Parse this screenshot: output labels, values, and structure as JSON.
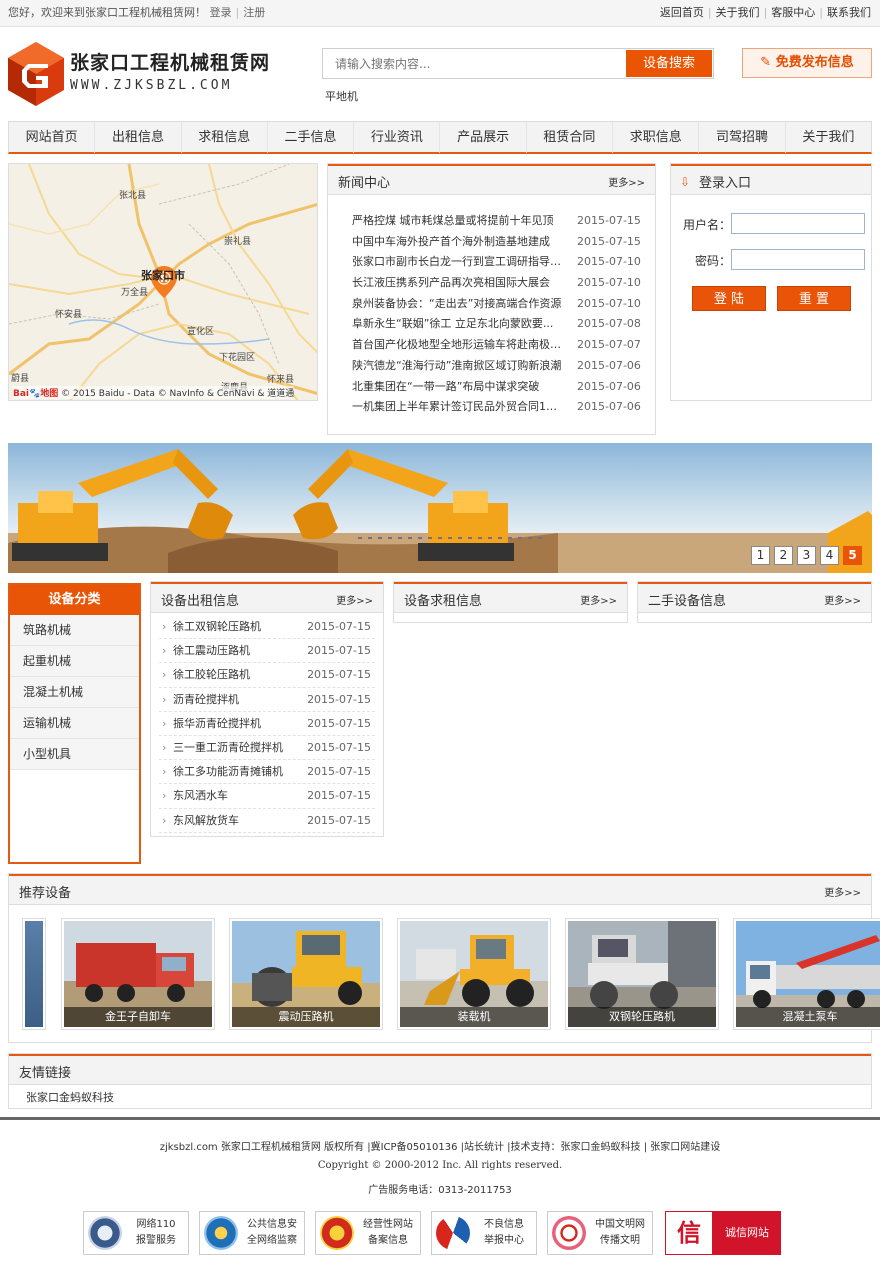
{
  "topbar": {
    "welcome": "您好，欢迎来到张家口工程机械租赁网！",
    "login": "登录",
    "register": "注册",
    "links": [
      "返回首页",
      "关于我们",
      "客服中心",
      "联系我们"
    ]
  },
  "header": {
    "logo_cn": "张家口工程机械租赁网",
    "logo_en": "WWW.ZJKSBZL.COM",
    "search_placeholder": "请输入搜索内容...",
    "search_button": "设备搜索",
    "hot_keyword": "平地机",
    "publish_button": "免费发布信息"
  },
  "nav": [
    "网站首页",
    "出租信息",
    "求租信息",
    "二手信息",
    "行业资讯",
    "产品展示",
    "租赁合同",
    "求职信息",
    "司驾招聘",
    "关于我们"
  ],
  "map": {
    "labels": [
      "张北县",
      "崇礼县",
      "张家口市",
      "万全县",
      "怀安县",
      "宣化区",
      "下花园区",
      "怀来县",
      "涿鹿县",
      "蔚县"
    ],
    "copyright": "© 2015 Baidu - Data © NavInfo & CenNavi & 道道通",
    "brand": "Bai",
    "brand2": "地图"
  },
  "news": {
    "title": "新闻中心",
    "more": "更多>>",
    "items": [
      {
        "title": "严格控煤 城市耗煤总量或将提前十年见顶",
        "date": "2015-07-15"
      },
      {
        "title": "中国中车海外投产首个海外制造基地建成",
        "date": "2015-07-15"
      },
      {
        "title": "张家口市副市长白龙一行到宣工调研指导工作",
        "date": "2015-07-10"
      },
      {
        "title": "长江液压携系列产品再次亮相国际大展会",
        "date": "2015-07-10"
      },
      {
        "title": "泉州装备协会：“走出去”对接高端合作资源",
        "date": "2015-07-10"
      },
      {
        "title": "阜新永生“联姻”徐工 立足东北向蒙欧要...",
        "date": "2015-07-08"
      },
      {
        "title": "首台国产化极地型全地形运输车将赴南极科考",
        "date": "2015-07-07"
      },
      {
        "title": "陕汽德龙“淮海行动”淮南掀区域订购新浪潮",
        "date": "2015-07-06"
      },
      {
        "title": "北重集团在“一带一路”布局中谋求突破",
        "date": "2015-07-06"
      },
      {
        "title": "一机集团上半年累计签订民品外贸合同11...",
        "date": "2015-07-06"
      }
    ]
  },
  "login": {
    "title": "登录入口",
    "username_label": "用户名：",
    "password_label": "密码：",
    "login_button": "登 陆",
    "reset_button": "重 置"
  },
  "banner": {
    "pages": [
      "1",
      "2",
      "3",
      "4",
      "5"
    ],
    "active": 5
  },
  "category": {
    "title": "设备分类",
    "items": [
      "筑路机械",
      "起重机械",
      "混凝土机械",
      "运输机械",
      "小型机具"
    ]
  },
  "rent_out": {
    "title": "设备出租信息",
    "more": "更多>>",
    "items": [
      {
        "title": "徐工双钢轮压路机",
        "date": "2015-07-15"
      },
      {
        "title": "徐工震动压路机",
        "date": "2015-07-15"
      },
      {
        "title": "徐工胶轮压路机",
        "date": "2015-07-15"
      },
      {
        "title": "沥青砼搅拌机",
        "date": "2015-07-15"
      },
      {
        "title": "振华沥青砼搅拌机",
        "date": "2015-07-15"
      },
      {
        "title": "三一重工沥青砼搅拌机",
        "date": "2015-07-15"
      },
      {
        "title": "徐工多功能沥青摊铺机",
        "date": "2015-07-15"
      },
      {
        "title": "东风洒水车",
        "date": "2015-07-15"
      },
      {
        "title": "东风解放货车",
        "date": "2015-07-15"
      }
    ]
  },
  "rent_in": {
    "title": "设备求租信息",
    "more": "更多>>"
  },
  "second_hand": {
    "title": "二手设备信息",
    "more": "更多>>"
  },
  "recommend": {
    "title": "推荐设备",
    "more": "更多>>",
    "items": [
      "金王子自卸车",
      "震动压路机",
      "装载机",
      "双钢轮压路机",
      "混凝土泵车"
    ]
  },
  "friend_links": {
    "title": "友情链接",
    "items": [
      "张家口金蚂蚁科技"
    ]
  },
  "footer": {
    "line1": "zjksbzl.com 张家口工程机械租赁网 版权所有 |冀ICP备05010136 |站长统计 |技术支持：张家口金蚂蚁科技 | 张家口网站建设",
    "line2": "Copyright © 2000-2012 Inc. All rights reserved.",
    "line3": "广告服务电话：0313-2011753",
    "badges": [
      {
        "l1": "网络110",
        "l2": "报警服务"
      },
      {
        "l1": "公共信息安",
        "l2": "全网络监察"
      },
      {
        "l1": "经营性网站",
        "l2": "备案信息"
      },
      {
        "l1": "不良信息",
        "l2": "举报中心"
      },
      {
        "l1": "中国文明网",
        "l2": "传播文明"
      },
      {
        "l1": "诚信网站",
        "l2": ""
      }
    ],
    "last_badge_glyph": "信"
  },
  "colors": {
    "accent": "#e35a12",
    "button": "#ea5504"
  }
}
